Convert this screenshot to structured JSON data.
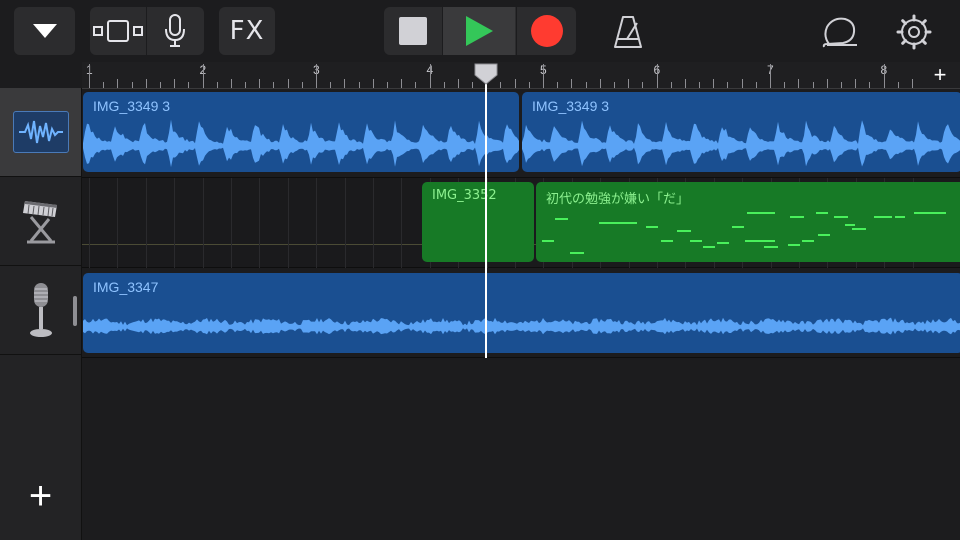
{
  "toolbar": {
    "icons": [
      "triangle-down-icon",
      "tracks-view-icon",
      "microphone-icon",
      "stop-icon",
      "play-icon",
      "record-icon",
      "metronome-icon",
      "loop-icon",
      "settings-gear-icon"
    ],
    "fx_label": "FX"
  },
  "ruler": {
    "bars": [
      "1",
      "2",
      "3",
      "4",
      "5",
      "6",
      "7",
      "8"
    ],
    "add_label": "+"
  },
  "tracks": [
    {
      "name": "audio-recorder",
      "icon": "waveform-icon",
      "selected": true
    },
    {
      "name": "keyboard",
      "icon": "keyboard-icon",
      "selected": false
    },
    {
      "name": "microphone",
      "icon": "microphone-icon",
      "selected": false
    }
  ],
  "regions": {
    "track1_a": "IMG_3349 3",
    "track1_b": "IMG_3349 3",
    "track2_a": "IMG_3352",
    "track2_b": "初代の勉強が嫌い「だ」",
    "track3_a": "IMG_3347"
  },
  "add_track_label": "+",
  "colors": {
    "audio_region": "#1a4f91",
    "audio_wave": "#5aa3f5",
    "midi_region": "#177a26",
    "midi_note": "#49f05b",
    "play_green": "#34c759",
    "record_red": "#ff3b30"
  }
}
